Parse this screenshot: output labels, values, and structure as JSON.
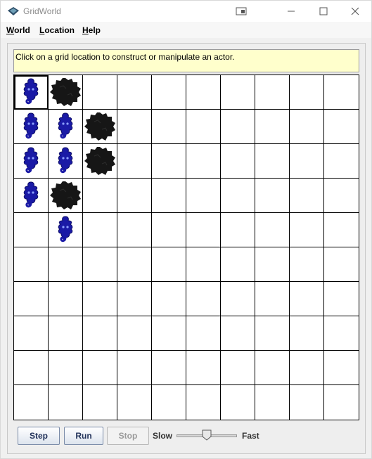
{
  "window": {
    "title": "GridWorld",
    "icon": "gridworld-app-icon"
  },
  "menu": {
    "items": [
      {
        "label": "World",
        "mnemonic": "W",
        "rest": "orld"
      },
      {
        "label": "Location",
        "mnemonic": "L",
        "rest": "ocation"
      },
      {
        "label": "Help",
        "mnemonic": "H",
        "rest": "elp"
      }
    ]
  },
  "message": "Click on a grid location to construct or manipulate an actor.",
  "grid": {
    "rows": 10,
    "cols": 10,
    "selected": [
      0,
      0
    ],
    "actors": [
      {
        "row": 0,
        "col": 0,
        "type": "bug"
      },
      {
        "row": 0,
        "col": 1,
        "type": "rock"
      },
      {
        "row": 1,
        "col": 0,
        "type": "bug"
      },
      {
        "row": 1,
        "col": 1,
        "type": "bug"
      },
      {
        "row": 1,
        "col": 2,
        "type": "rock"
      },
      {
        "row": 2,
        "col": 0,
        "type": "bug"
      },
      {
        "row": 2,
        "col": 1,
        "type": "bug"
      },
      {
        "row": 2,
        "col": 2,
        "type": "rock"
      },
      {
        "row": 3,
        "col": 0,
        "type": "bug"
      },
      {
        "row": 3,
        "col": 1,
        "type": "rock"
      },
      {
        "row": 4,
        "col": 1,
        "type": "bug"
      }
    ],
    "colors": {
      "bug": "#1a1aa6",
      "rock": "#161616"
    }
  },
  "controls": {
    "step_label": "Step",
    "run_label": "Run",
    "stop_label": "Stop",
    "slow_label": "Slow",
    "fast_label": "Fast",
    "speed_fraction": 0.5
  }
}
